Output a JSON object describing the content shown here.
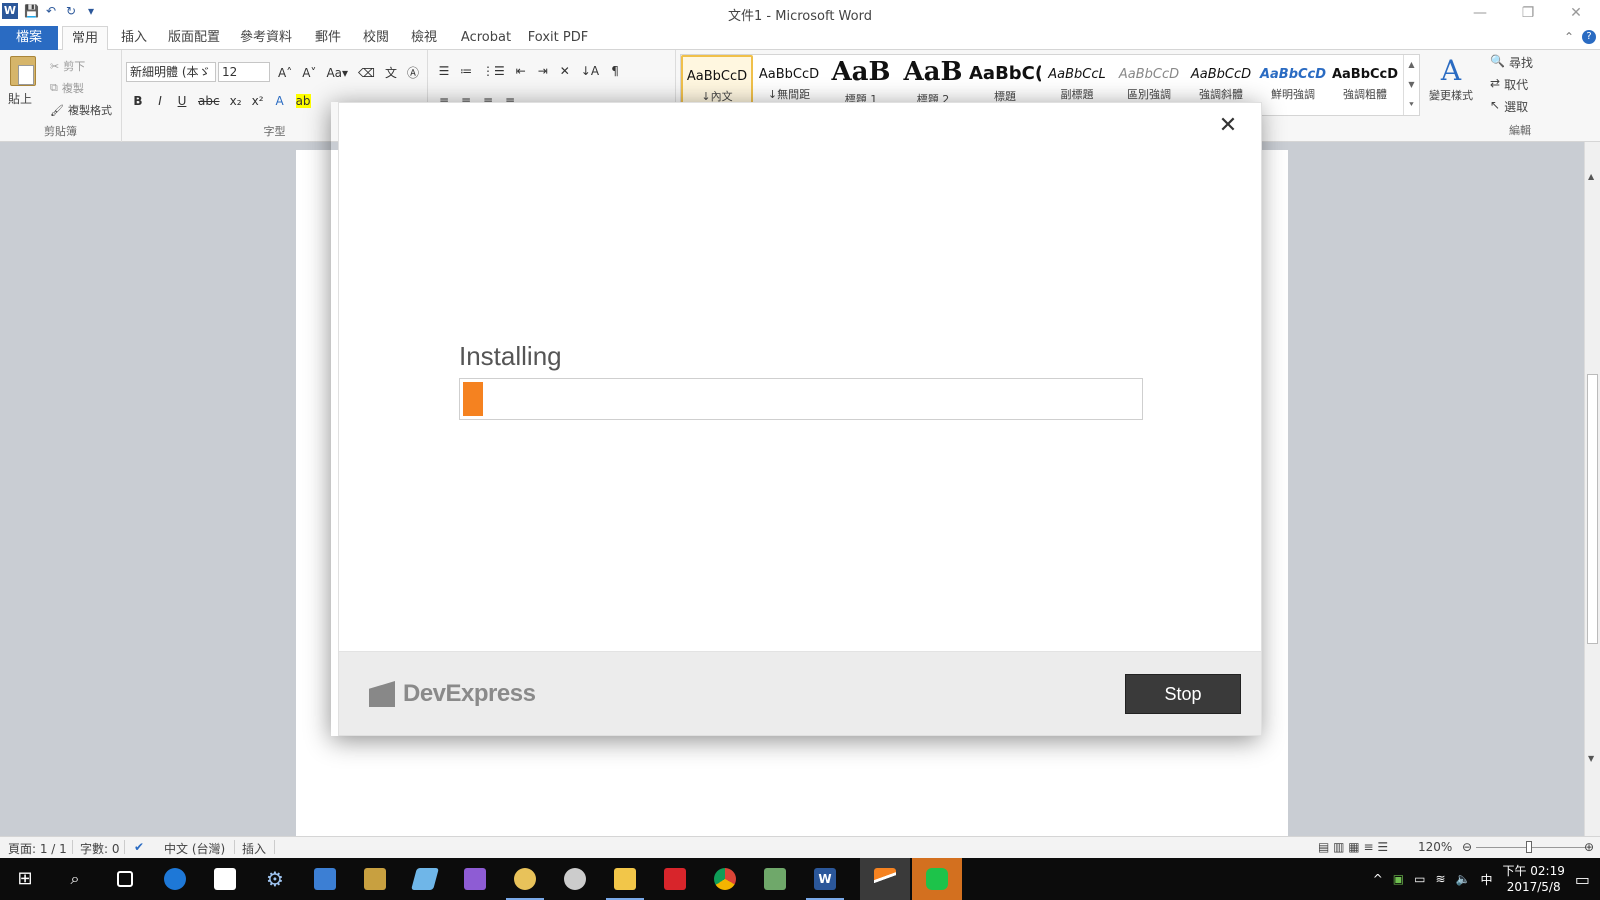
{
  "window": {
    "title": "文件1 - Microsoft Word",
    "controls": [
      "—",
      "❐",
      "✕"
    ]
  },
  "quick_access": {
    "icons": [
      "word-logo-icon",
      "save-icon",
      "undo-icon",
      "redo-icon",
      "customize-icon"
    ]
  },
  "tabs": [
    {
      "label": "檔案",
      "type": "file"
    },
    {
      "label": "常用",
      "type": "active"
    },
    {
      "label": "插入"
    },
    {
      "label": "版面配置"
    },
    {
      "label": "參考資料"
    },
    {
      "label": "郵件"
    },
    {
      "label": "校閱"
    },
    {
      "label": "檢視"
    },
    {
      "label": "Acrobat"
    },
    {
      "label": "Foxit PDF"
    }
  ],
  "ribbon": {
    "clipboard": {
      "paste": "貼上",
      "cut": "剪下",
      "copy": "複製",
      "format_painter": "複製格式",
      "group_label": "剪貼簿"
    },
    "font": {
      "font_name": "新細明體 (本ゞ",
      "font_size": "12",
      "group_label": "字型"
    },
    "styles": [
      {
        "sample": "AaBbCcD",
        "name": "↓內文"
      },
      {
        "sample": "AaBbCcD",
        "name": "↓無間距"
      },
      {
        "sample": "AaB",
        "name": "標題 1"
      },
      {
        "sample": "AaB",
        "name": "標題 2"
      },
      {
        "sample": "AaBbC(",
        "name": "標題"
      },
      {
        "sample": "AaBbCcL",
        "name": "副標題"
      },
      {
        "sample": "AaBbCcD",
        "name": "區別強調"
      },
      {
        "sample": "AaBbCcD",
        "name": "強調斜體"
      },
      {
        "sample": "AaBbCcD",
        "name": "鮮明強調"
      },
      {
        "sample": "AaBbCcD",
        "name": "強調粗體"
      }
    ],
    "change_styles": "變更樣式",
    "editing": {
      "find": "尋找",
      "replace": "取代",
      "select": "選取",
      "group_label": "編輯"
    }
  },
  "statusbar": {
    "page": "頁面: 1 / 1",
    "words": "字數: 0",
    "language": "中文 (台灣)",
    "mode": "插入",
    "zoom": "120%"
  },
  "dialog": {
    "status": "Installing",
    "progress": 0.03,
    "brand": "DevExpress",
    "stop_label": "Stop",
    "accent": "#f58220"
  },
  "taskbar": {
    "time": "下午 02:19",
    "date": "2017/5/8",
    "ime": "中"
  }
}
